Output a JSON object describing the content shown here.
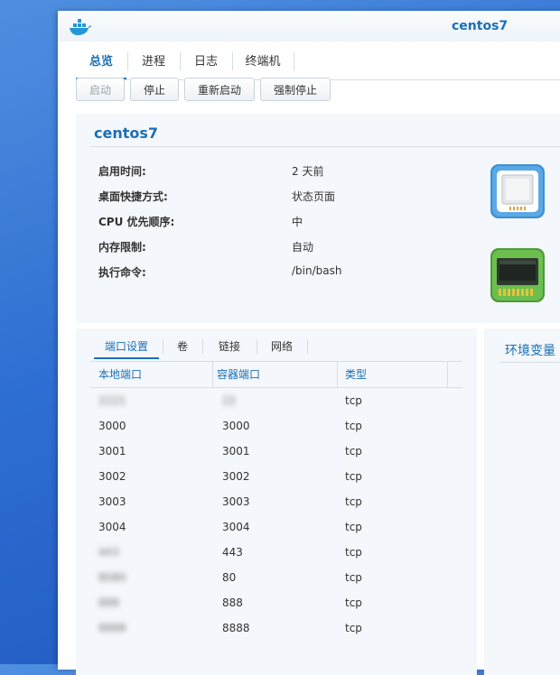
{
  "window": {
    "title": "centos7",
    "tabs": [
      "总览",
      "进程",
      "日志",
      "终端机"
    ],
    "active_tab": 0
  },
  "toolbar": {
    "start": "启动",
    "stop": "停止",
    "restart": "重新启动",
    "force_stop": "强制停止"
  },
  "info": {
    "name": "centos7",
    "rows": [
      {
        "label": "启用时间:",
        "value": "2 天前"
      },
      {
        "label": "桌面快捷方式:",
        "value": "状态页面"
      },
      {
        "label": "CPU 优先顺序:",
        "value": "中"
      },
      {
        "label": "内存限制:",
        "value": "自动"
      },
      {
        "label": "执行命令:",
        "value": "/bin/bash"
      }
    ],
    "icons": [
      "cpu-chip-icon",
      "memory-module-icon"
    ]
  },
  "subtabs": [
    "端口设置",
    "卷",
    "链接",
    "网络"
  ],
  "ports": {
    "headers": [
      "本地端口",
      "容器端口",
      "类型"
    ],
    "rows": [
      {
        "local": "2221",
        "container": "22",
        "type": "tcp",
        "blurred": true
      },
      {
        "local": "3000",
        "container": "3000",
        "type": "tcp"
      },
      {
        "local": "3001",
        "container": "3001",
        "type": "tcp"
      },
      {
        "local": "3002",
        "container": "3002",
        "type": "tcp"
      },
      {
        "local": "3003",
        "container": "3003",
        "type": "tcp"
      },
      {
        "local": "3004",
        "container": "3004",
        "type": "tcp"
      },
      {
        "local": "443",
        "container": "443",
        "type": "tcp",
        "blurred": true
      },
      {
        "local": "8080",
        "container": "80",
        "type": "tcp",
        "blurred": true
      },
      {
        "local": "888",
        "container": "888",
        "type": "tcp",
        "blurred": true
      },
      {
        "local": "8888",
        "container": "8888",
        "type": "tcp",
        "blurred": true
      }
    ]
  },
  "env": {
    "title": "环境变量"
  },
  "colors": {
    "accent": "#1b6fb5",
    "panel_bg": "#f4f7fb",
    "desktop_bg": "#2e6fd2"
  }
}
